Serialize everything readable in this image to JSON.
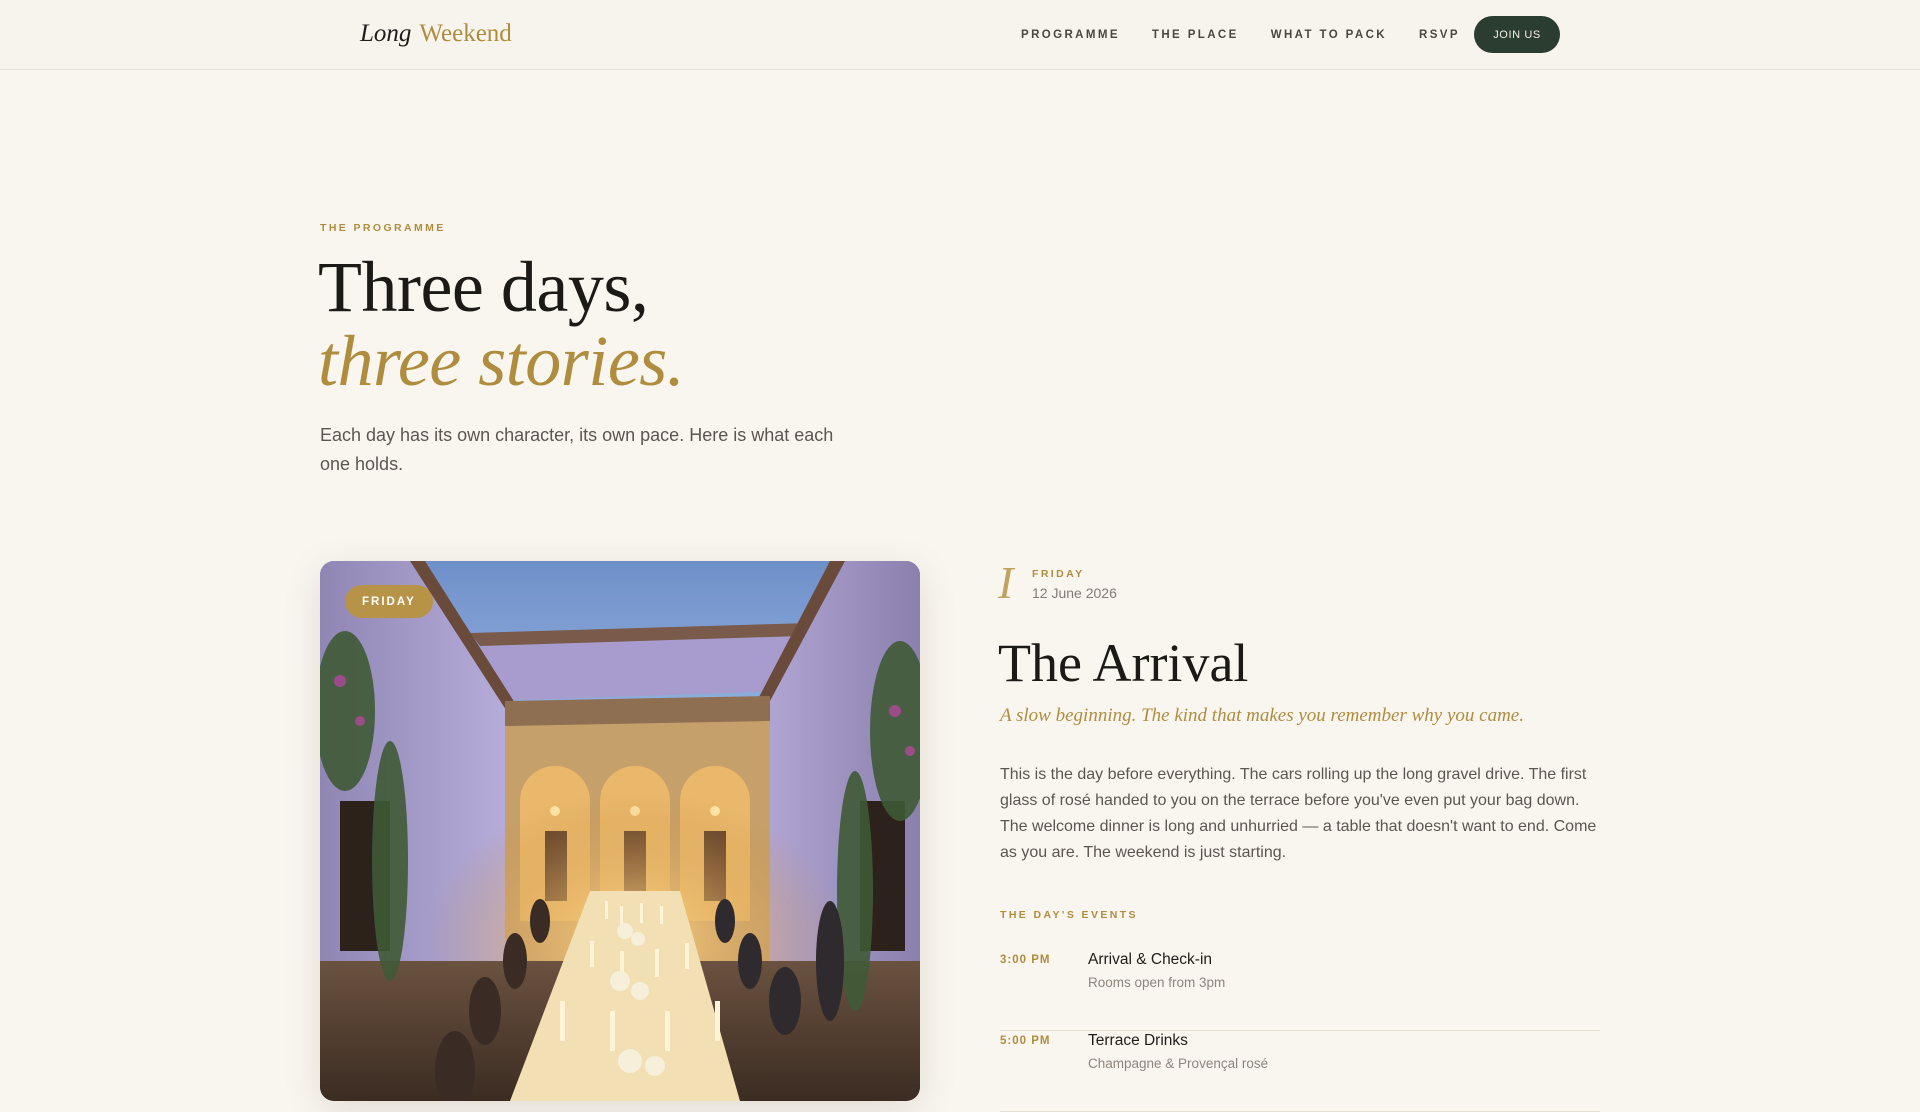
{
  "nav": {
    "logo_italic": "Long",
    "logo_plain": "Weekend",
    "links": [
      "PROGRAMME",
      "THE PLACE",
      "WHAT TO PACK",
      "RSVP"
    ],
    "cta": "JOIN US"
  },
  "hero": {
    "eyebrow": "THE PROGRAMME",
    "headline_line1": "Three days,",
    "headline_line2": "three stories.",
    "intro": "Each day has its own character, its own pace. Here is what each one holds."
  },
  "day": {
    "badge": "FRIDAY",
    "numeral": "I",
    "name": "FRIDAY",
    "date": "12 June 2026",
    "title": "The Arrival",
    "tagline": "A slow beginning. The kind that makes you remember why you came.",
    "description": "This is the day before everything. The cars rolling up the long gravel drive. The first glass of rosé handed to you on the terrace before you've even put your bag down. The welcome dinner is long and unhurried — a table that doesn't want to end. Come as you are. The weekend is just starting.",
    "events_label": "THE DAY'S EVENTS",
    "events": [
      {
        "time": "3:00 PM",
        "title": "Arrival & Check-in",
        "sub": "Rooms open from 3pm"
      },
      {
        "time": "5:00 PM",
        "title": "Terrace Drinks",
        "sub": "Champagne & Provençal rosé"
      }
    ]
  },
  "colors": {
    "background": "#f9f6f0",
    "gold": "#b08d3e",
    "dark_green": "#2b3d31",
    "ink": "#1c1a17"
  }
}
